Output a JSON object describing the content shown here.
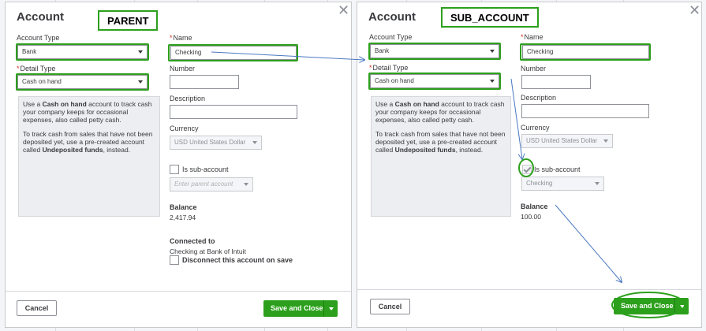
{
  "parent": {
    "title": "Account",
    "badge": "PARENT",
    "account_type_label": "Account Type",
    "account_type_value": "Bank",
    "detail_type_label": "Detail Type",
    "detail_type_value": "Cash on hand",
    "info_p1_a": "Use a ",
    "info_p1_b": "Cash on hand",
    "info_p1_c": " account to track cash your company keeps for occasional expenses, also called petty cash.",
    "info_p2_a": "To track cash from sales that have not been deposited yet, use a pre-created account called ",
    "info_p2_b": "Undeposited funds",
    "info_p2_c": ", instead.",
    "name_label": "Name",
    "name_value": "Checking",
    "number_label": "Number",
    "number_value": "",
    "description_label": "Description",
    "description_value": "",
    "currency_label": "Currency",
    "currency_value": "USD United States Dollar",
    "sub_account_label": "Is sub-account",
    "parent_account_placeholder": "Enter parent account",
    "balance_label": "Balance",
    "balance_value": "2,417.94",
    "connected_label": "Connected to",
    "connected_value": "Checking at Bank of Intuit",
    "disconnect_label": "Disconnect this account on save",
    "cancel_label": "Cancel",
    "save_label": "Save and Close"
  },
  "sub": {
    "title": "Account",
    "badge": "SUB_ACCOUNT",
    "account_type_label": "Account Type",
    "account_type_value": "Bank",
    "detail_type_label": "Detail Type",
    "detail_type_value": "Cash on hand",
    "info_p1_a": "Use a ",
    "info_p1_b": "Cash on hand",
    "info_p1_c": " account to track cash your company keeps for occasional expenses, also called petty cash.",
    "info_p2_a": "To track cash from sales that have not been deposited yet, use a pre-created account called ",
    "info_p2_b": "Undeposited funds",
    "info_p2_c": ", instead.",
    "name_label": "Name",
    "name_value": "Checking",
    "number_label": "Number",
    "number_value": "",
    "description_label": "Description",
    "description_value": "",
    "currency_label": "Currency",
    "currency_value": "USD United States Dollar",
    "sub_account_label": "Is sub-account",
    "parent_account_value": "Checking",
    "balance_label": "Balance",
    "balance_value": "100.00",
    "cancel_label": "Cancel",
    "save_label": "Save and Close"
  },
  "colors": {
    "highlight": "#2ca01c",
    "annotation_arrow": "#4a78c2",
    "button_primary": "#2ca01c"
  },
  "icons": {
    "close": "close-icon",
    "dropdown": "chevron-down-icon",
    "checkbox": "checkbox-icon"
  }
}
